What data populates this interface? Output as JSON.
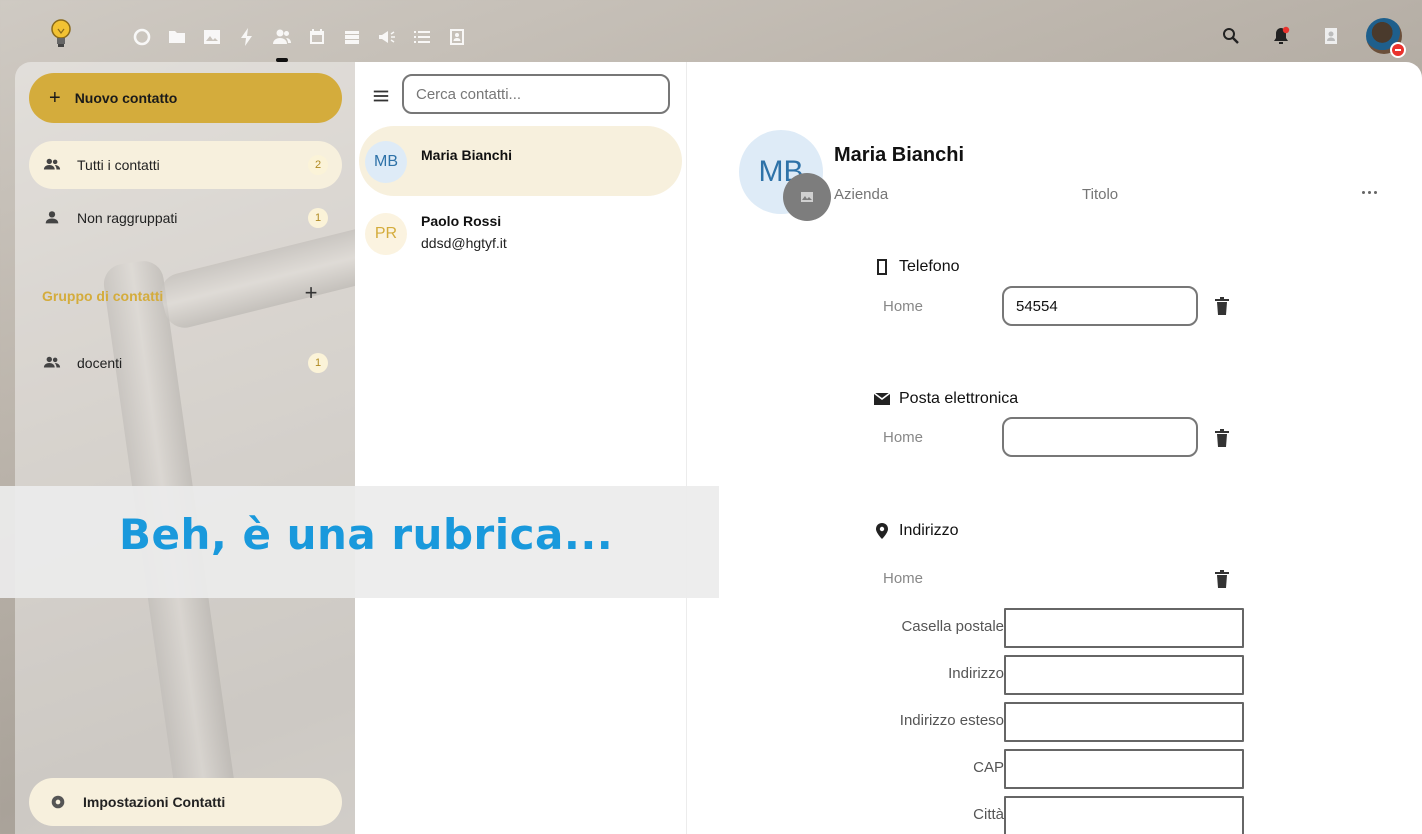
{
  "header": {
    "nav_icons": [
      "dashboard-icon",
      "files-icon",
      "photos-icon",
      "activity-icon",
      "contacts-icon",
      "calendar-icon",
      "deck-icon",
      "announcements-icon",
      "tasks-icon",
      "addressbook-icon"
    ],
    "active_app": "contacts-icon",
    "right_icons": [
      "search-icon",
      "notifications-icon",
      "contacts-menu-icon",
      "user-avatar"
    ]
  },
  "sidebar": {
    "new_contact_label": "Nuovo contatto",
    "items": [
      {
        "label": "Tutti i contatti",
        "count": "2",
        "icon": "people-icon"
      },
      {
        "label": "Non raggruppati",
        "count": "1",
        "icon": "person-icon"
      }
    ],
    "group_caption": "Gruppo di contatti",
    "groups": [
      {
        "label": "docenti",
        "count": "1",
        "icon": "people-icon"
      }
    ],
    "settings_label": "Impostazioni Contatti"
  },
  "list": {
    "search_placeholder": "Cerca contatti...",
    "contacts": [
      {
        "initials": "MB",
        "name": "Maria Bianchi",
        "sub": ""
      },
      {
        "initials": "PR",
        "name": "Paolo Rossi",
        "sub": "ddsd@hgtyf.it"
      }
    ]
  },
  "detail": {
    "initials": "MB",
    "name": "Maria Bianchi",
    "company_placeholder": "Azienda",
    "title_placeholder": "Titolo",
    "phone": {
      "title": "Telefono",
      "type": "Home",
      "value": "54554"
    },
    "email": {
      "title": "Posta elettronica",
      "type": "Home",
      "value": ""
    },
    "address": {
      "title": "Indirizzo",
      "type": "Home",
      "fields": [
        "Casella postale",
        "Indirizzo",
        "Indirizzo esteso",
        "CAP",
        "Città"
      ]
    }
  },
  "overlay": {
    "text": "Beh, è una rubrica..."
  },
  "colors": {
    "accent": "#d4ac3c",
    "active_item_bg": "#f7f0dd",
    "overlay_text": "#1999dc",
    "avatar_blue": "#deebf7"
  }
}
